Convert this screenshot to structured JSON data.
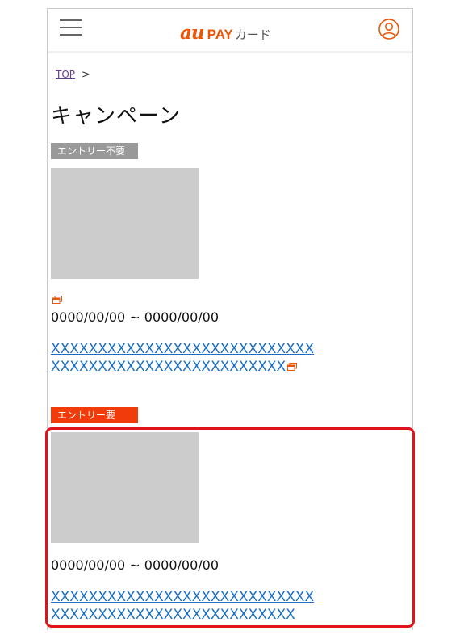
{
  "header": {
    "logo": {
      "au": "au",
      "pay": "PAY",
      "card": "カード"
    },
    "menu_icon": "hamburger-menu-icon",
    "user_icon": "user-account-icon"
  },
  "breadcrumb": {
    "top_label": "TOP",
    "separator": ">"
  },
  "page_title": "キャンペーン",
  "campaigns": [
    {
      "badge": "エントリー不要",
      "badge_color": "#999999",
      "external_icon": "external-link-icon",
      "period": "0000/00/00 ~ 0000/00/00",
      "title": "XXXXXXXXXXXXXXXXXXXXXXXXXXXXXXXXXXXXXXXXXXXXXXXXXXXXX",
      "title_has_external_icon": true
    },
    {
      "badge": "エントリー要",
      "badge_color": "#f23b0a",
      "period": "0000/00/00 ~ 0000/00/00",
      "title": "XXXXXXXXXXXXXXXXXXXXXXXXXXXXXXXXXXXXXXXXXXXXXXXXXXXXXX",
      "highlighted": true,
      "highlight_color": "#e0131a"
    }
  ],
  "colors": {
    "brand": "#eb5505",
    "link": "#1a6fc4",
    "thumbnail": "#cccccc"
  }
}
